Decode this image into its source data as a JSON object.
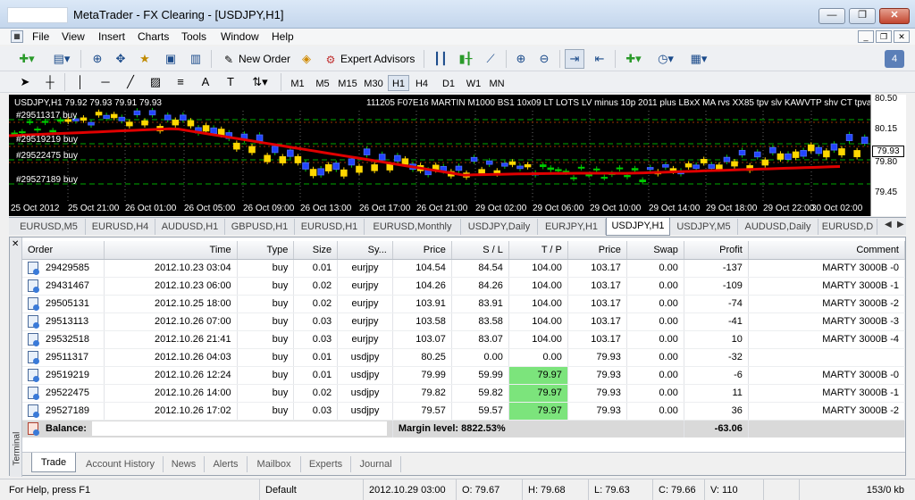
{
  "window": {
    "title": "MetaTrader - FX Clearing - [USDJPY,H1]",
    "minimize": "—",
    "restore": "❐",
    "close": "✕"
  },
  "menu": [
    "File",
    "View",
    "Insert",
    "Charts",
    "Tools",
    "Window",
    "Help"
  ],
  "toolbar": {
    "new_order": "New Order",
    "expert_advisors": "Expert Advisors"
  },
  "timeframes": [
    "M1",
    "M5",
    "M15",
    "M30",
    "H1",
    "H4",
    "D1",
    "W1",
    "MN"
  ],
  "active_timeframe": "H1",
  "chart": {
    "symbol_info": "USDJPY,H1  79.92 79.93 79.91 79.93",
    "indicators": "111205 F07E16 MARTIN M1000 BS1 10x09 LT LOTS LV minus 10p 2011 plus LBxX MA rvs XX85 tpv slv KAWVTP shv CT tpvalue",
    "order_lines": [
      "#29511317 buy",
      "#29519219 buy",
      "#29522475 buy",
      "#29527189 buy"
    ],
    "price_ticks": [
      "80.50",
      "80.15",
      "79.80",
      "79.45"
    ],
    "current_price": "79.93",
    "time_ticks": [
      "25 Oct 2012",
      "25 Oct 21:00",
      "26 Oct 01:00",
      "26 Oct 05:00",
      "26 Oct 09:00",
      "26 Oct 13:00",
      "26 Oct 17:00",
      "26 Oct 21:00",
      "29 Oct 02:00",
      "29 Oct 06:00",
      "29 Oct 10:00",
      "29 Oct 14:00",
      "29 Oct 18:00",
      "29 Oct 22:00",
      "30 Oct 02:00"
    ],
    "colors": {
      "bull": "#2244ff",
      "bear": "#ffd700",
      "doji": "#00cc00",
      "ma": "#e00000",
      "order_line": "#00aa00"
    }
  },
  "chart_tabs": [
    "EURUSD,M5",
    "EURUSD,H4",
    "AUDUSD,H1",
    "GBPUSD,H1",
    "EURUSD,H1",
    "EURUSD,Monthly",
    "USDJPY,Daily",
    "EURJPY,H1",
    "USDJPY,H1",
    "USDJPY,M5",
    "AUDUSD,Daily",
    "EURUSD,D"
  ],
  "active_chart_tab": "USDJPY,H1",
  "orders_table": {
    "columns": [
      "Order",
      "Time",
      "Type",
      "Size",
      "Sy...",
      "Price",
      "S / L",
      "T / P",
      "Price",
      "Swap",
      "Profit",
      "Comment"
    ],
    "rows": [
      [
        "29429585",
        "2012.10.23 03:04",
        "buy",
        "0.01",
        "eurjpy",
        "104.54",
        "84.54",
        "104.00",
        "103.17",
        "0.00",
        "-137",
        "MARTY 3000B -0"
      ],
      [
        "29431467",
        "2012.10.23 06:00",
        "buy",
        "0.02",
        "eurjpy",
        "104.26",
        "84.26",
        "104.00",
        "103.17",
        "0.00",
        "-109",
        "MARTY 3000B -1"
      ],
      [
        "29505131",
        "2012.10.25 18:00",
        "buy",
        "0.02",
        "eurjpy",
        "103.91",
        "83.91",
        "104.00",
        "103.17",
        "0.00",
        "-74",
        "MARTY 3000B -2"
      ],
      [
        "29513113",
        "2012.10.26 07:00",
        "buy",
        "0.03",
        "eurjpy",
        "103.58",
        "83.58",
        "104.00",
        "103.17",
        "0.00",
        "-41",
        "MARTY 3000B -3"
      ],
      [
        "29532518",
        "2012.10.26 21:41",
        "buy",
        "0.03",
        "eurjpy",
        "103.07",
        "83.07",
        "104.00",
        "103.17",
        "0.00",
        "10",
        "MARTY 3000B -4"
      ],
      [
        "29511317",
        "2012.10.26 04:03",
        "buy",
        "0.01",
        "usdjpy",
        "80.25",
        "0.00",
        "0.00",
        "79.93",
        "0.00",
        "-32",
        ""
      ],
      [
        "29519219",
        "2012.10.26 12:24",
        "buy",
        "0.01",
        "usdjpy",
        "79.99",
        "59.99",
        "79.97",
        "79.93",
        "0.00",
        "-6",
        "MARTY 3000B -0"
      ],
      [
        "29522475",
        "2012.10.26 14:00",
        "buy",
        "0.02",
        "usdjpy",
        "79.82",
        "59.82",
        "79.97",
        "79.93",
        "0.00",
        "11",
        "MARTY 3000B -1"
      ],
      [
        "29527189",
        "2012.10.26 17:02",
        "buy",
        "0.03",
        "usdjpy",
        "79.57",
        "59.57",
        "79.97",
        "79.93",
        "0.00",
        "36",
        "MARTY 3000B -2"
      ]
    ],
    "highlight_tp_rows": [
      6,
      7,
      8
    ],
    "balance_label": "Balance:",
    "margin_level": "Margin level: 8822.53%",
    "total_profit": "-63.06"
  },
  "terminal_label": "Terminal",
  "terminal_tabs": [
    "Trade",
    "Account History",
    "News",
    "Alerts",
    "Mailbox",
    "Experts",
    "Journal"
  ],
  "active_terminal_tab": "Trade",
  "status": {
    "help": "For Help, press F1",
    "profile": "Default",
    "datetime": "2012.10.29 03:00",
    "open": "O: 79.67",
    "high": "H: 79.68",
    "low": "L: 79.63",
    "close": "C: 79.66",
    "volume": "V: 110",
    "traffic": "153/0 kb"
  }
}
